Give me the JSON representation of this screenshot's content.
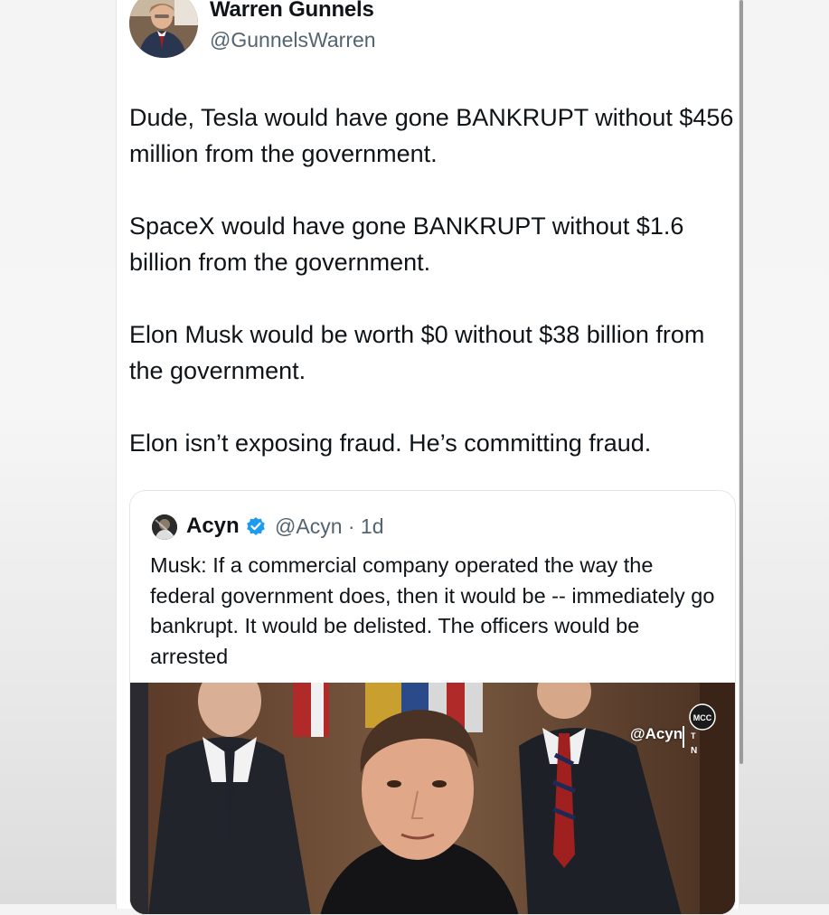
{
  "author": {
    "name": "Warren Gunnels",
    "handle": "@GunnelsWarren"
  },
  "tweet": {
    "paragraphs": [
      "Dude, Tesla would have gone BANKRUPT without $456 million from the government.",
      "SpaceX would have gone BANKRUPT without $1.6 billion from the government.",
      "Elon Musk would be worth $0 without $38 billion from the government.",
      "Elon isn’t exposing fraud. He’s committing fraud."
    ]
  },
  "quoted": {
    "name": "Acyn",
    "meta": "@Acyn · 1d",
    "verified_color": "#1d9bf0",
    "text": "Musk: If a commercial company operated the way the federal government does, then it would be -- immediately go bankrupt. It would be delisted. The officers would be arrested",
    "media_watermark": "@Acyn",
    "media_logo_text": [
      "MCC",
      "T",
      "N"
    ]
  },
  "icons": {
    "verified": "verified-badge-icon",
    "avatar_author": "author-avatar",
    "avatar_quoted": "quoted-avatar"
  }
}
